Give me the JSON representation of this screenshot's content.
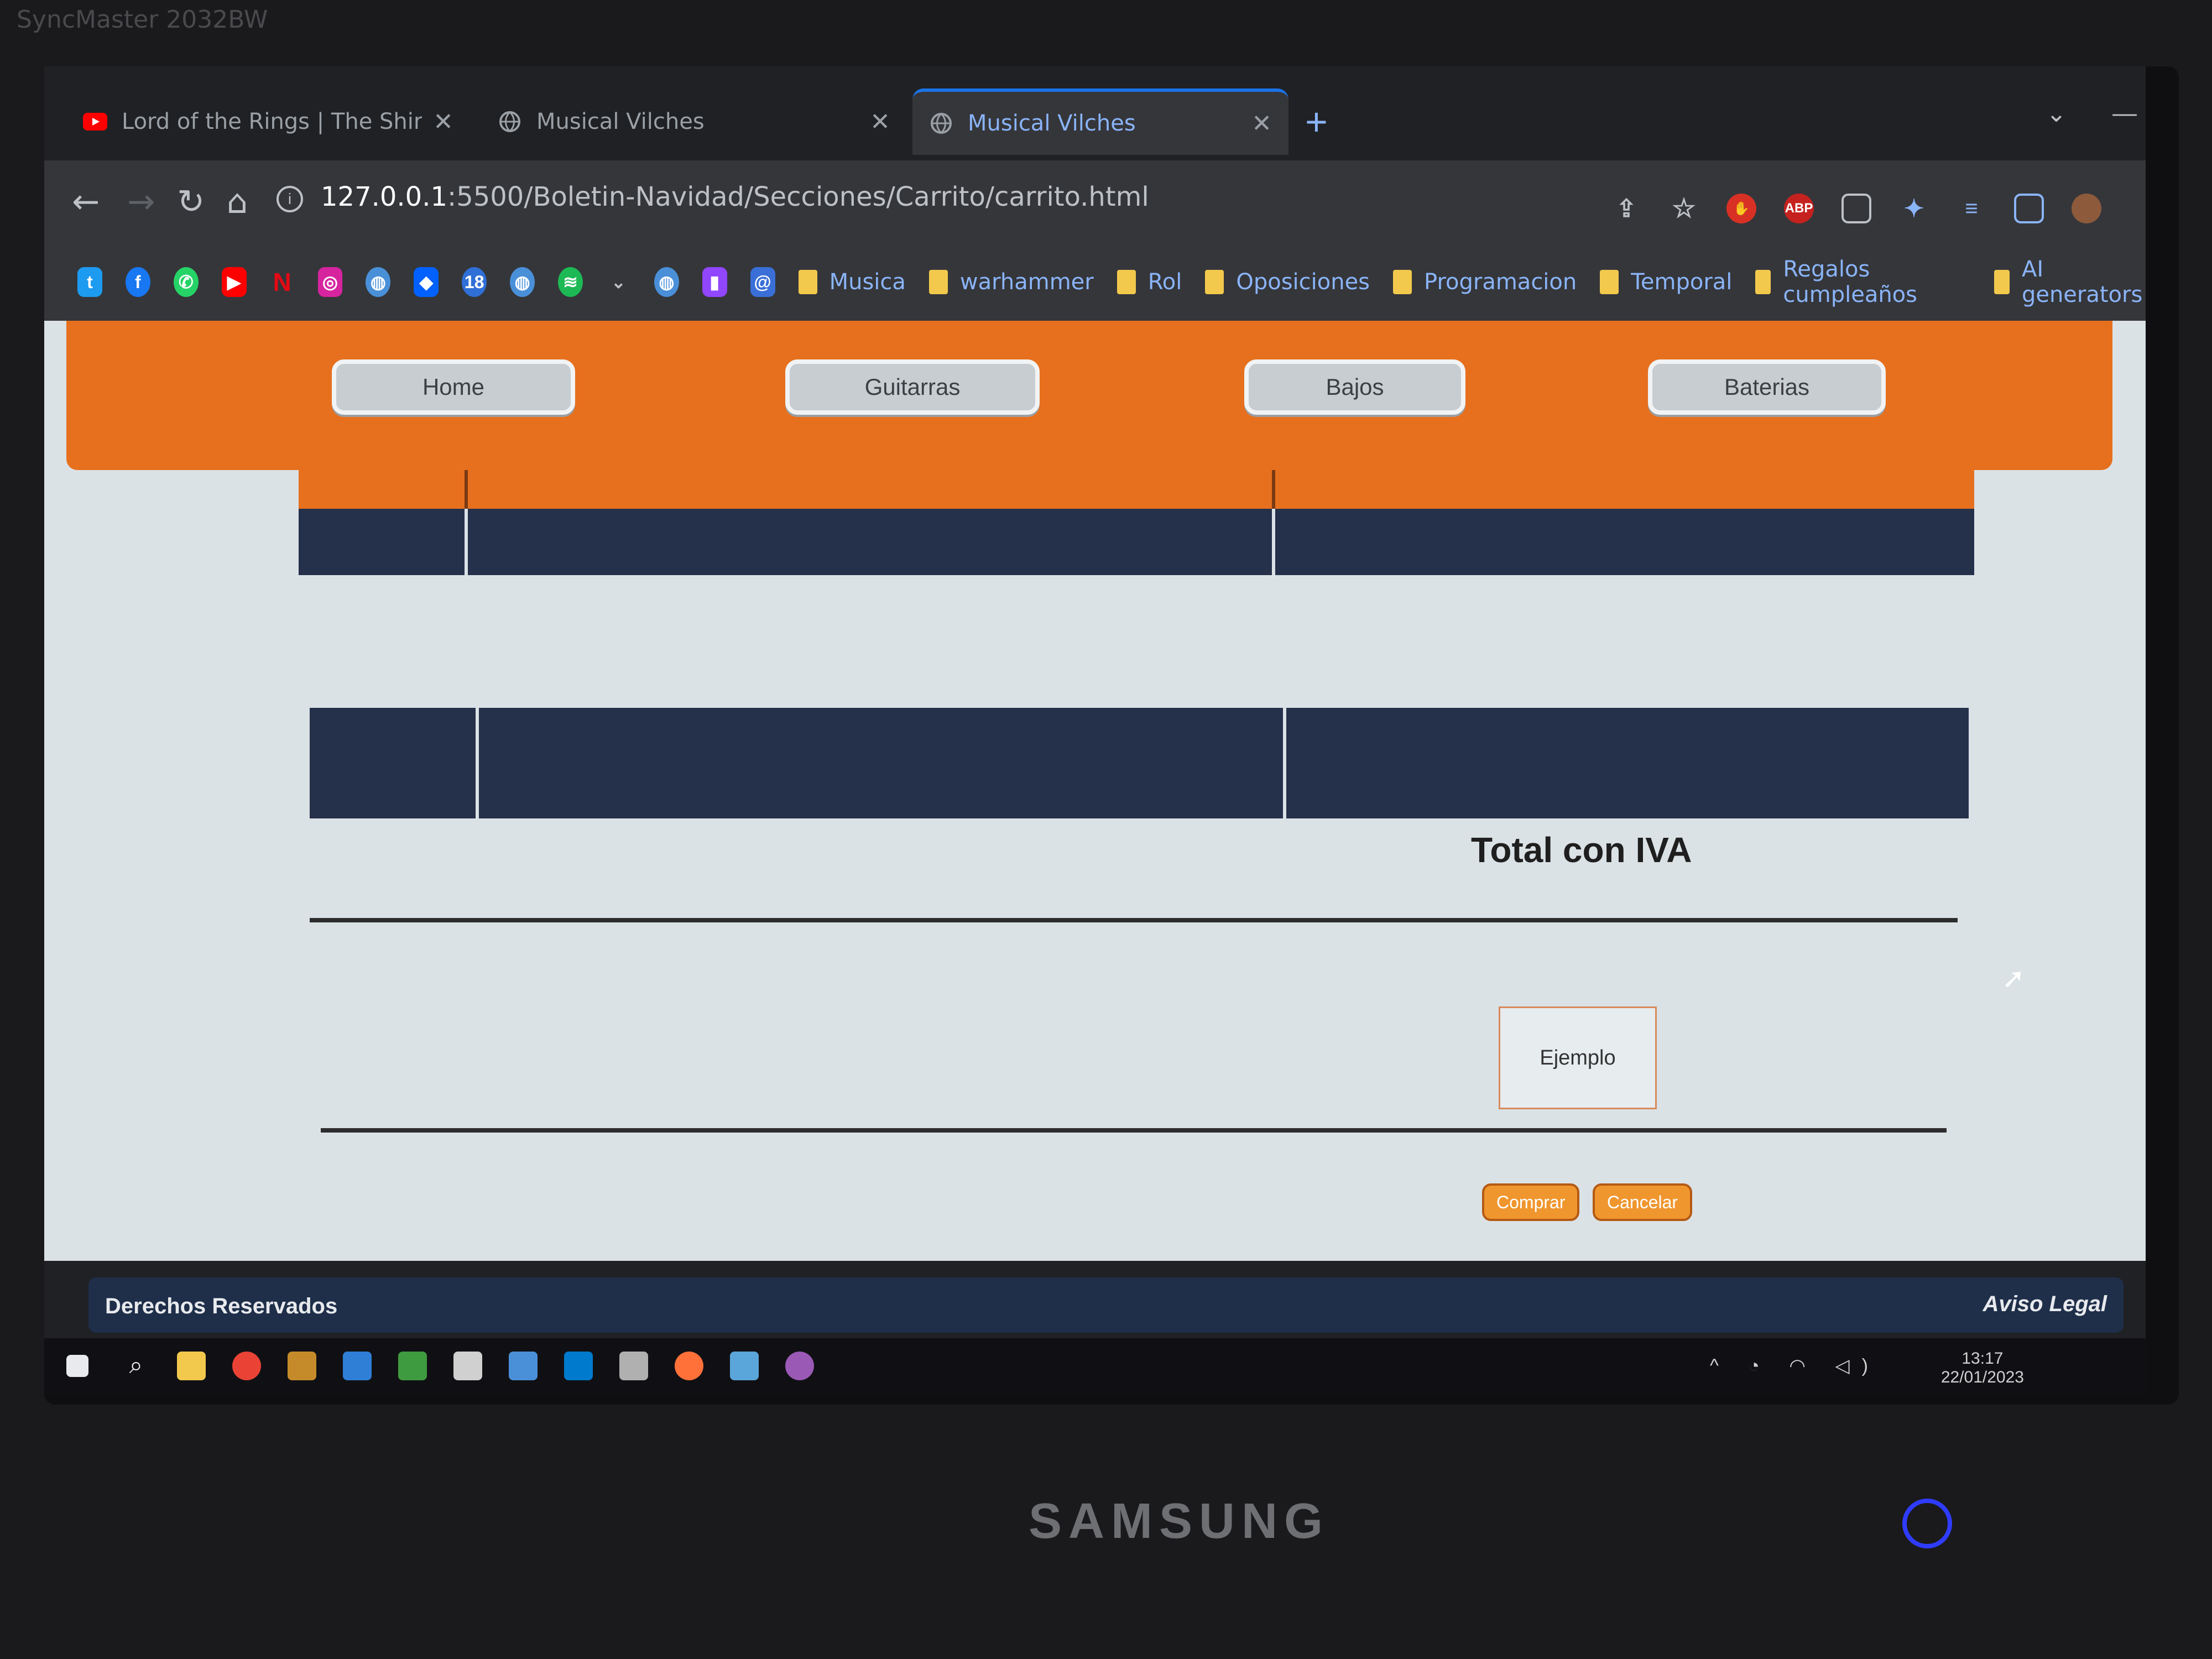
{
  "monitor": {
    "top_label": "SyncMaster 2032BW",
    "brand": "SAMSUNG"
  },
  "browser": {
    "tabs": [
      {
        "title": "Lord of the Rings | The Shire - N",
        "icon": "youtube-icon"
      },
      {
        "title": "Musical Vilches",
        "icon": "globe-icon"
      },
      {
        "title": "Musical Vilches",
        "icon": "globe-icon",
        "active": true
      }
    ],
    "url": {
      "host": "127.0.0.1",
      "path": ":5500/Boletin-Navidad/Secciones/Carrito/carrito.html"
    },
    "bookmark_folders": [
      "Musica",
      "warhammer",
      "Rol",
      "Oposiciones",
      "Programacion",
      "Temporal",
      "Regalos cumpleaños",
      "AI generators"
    ]
  },
  "nav": {
    "home": "Home",
    "guitarras": "Guitarras",
    "bajos": "Bajos",
    "baterias": "Baterias"
  },
  "cart": {
    "total_label": "Total con IVA",
    "example_value": "Ejemplo",
    "buy_label": "Comprar",
    "cancel_label": "Cancelar"
  },
  "footer": {
    "left": "Derechos Reservados",
    "right": "Aviso Legal"
  },
  "taskbar": {
    "time": "13:17",
    "date": "22/01/2023"
  },
  "colors": {
    "accent": "#e6701e",
    "dark_cell": "#25304a",
    "button": "#f0962e",
    "page_bg": "#dbe2e6"
  }
}
